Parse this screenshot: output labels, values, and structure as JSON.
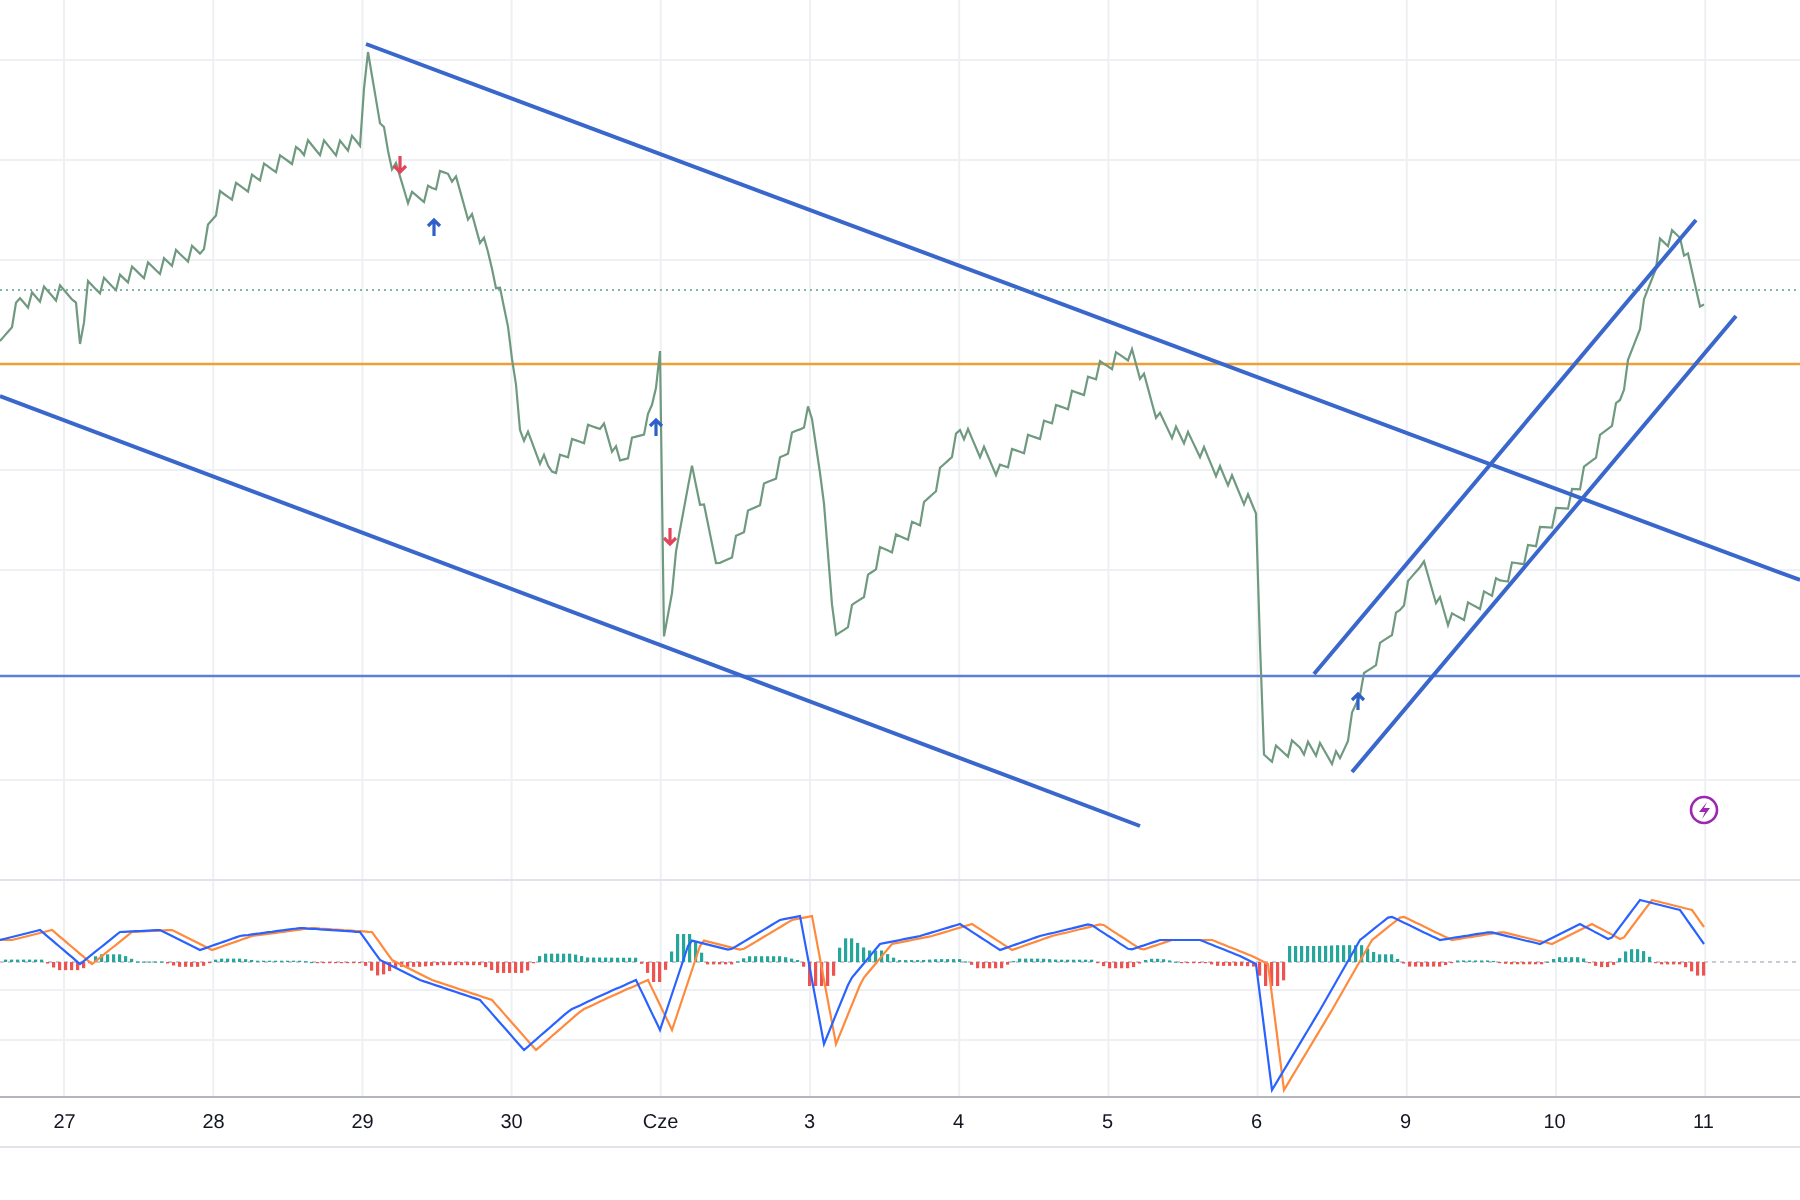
{
  "time_axis": {
    "labels": [
      "27",
      "28",
      "29",
      "30",
      "Cze",
      "3",
      "4",
      "5",
      "6",
      "9",
      "10",
      "11"
    ]
  }
}
